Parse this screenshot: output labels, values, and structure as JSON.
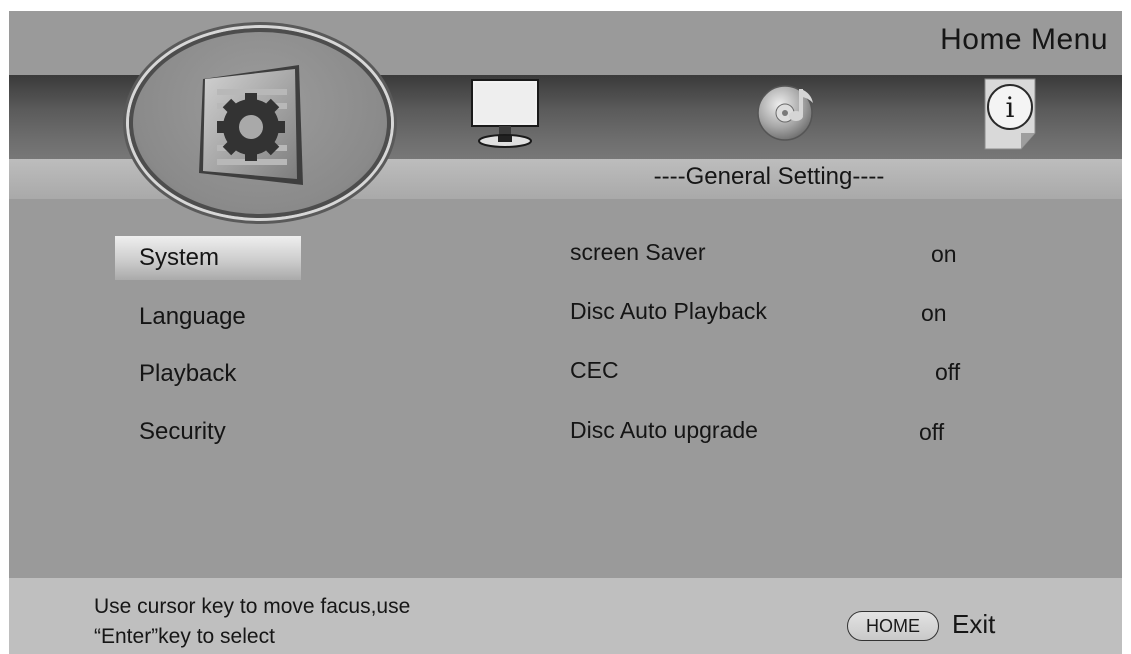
{
  "header": {
    "title": "Home  Menu"
  },
  "top_icons": [
    {
      "icon": "gear-settings-icon",
      "selected": true
    },
    {
      "icon": "monitor-display-icon",
      "selected": false
    },
    {
      "icon": "disc-music-icon",
      "selected": false
    },
    {
      "icon": "info-icon",
      "selected": false,
      "glyph": "i"
    }
  ],
  "section": {
    "title": "----General Setting----"
  },
  "left_menu": {
    "selected_index": 0,
    "items": [
      {
        "label": "System"
      },
      {
        "label": "Language"
      },
      {
        "label": "Playback"
      },
      {
        "label": "Security"
      }
    ]
  },
  "settings": [
    {
      "label": "screen Saver",
      "value": "on"
    },
    {
      "label": "Disc Auto Playback",
      "value": "on"
    },
    {
      "label": "CEC",
      "value": "off"
    },
    {
      "label": "Disc Auto upgrade",
      "value": "off"
    }
  ],
  "footer": {
    "hint_line1": "Use cursor key to move facus,use",
    "hint_line2": "“Enter”key to select",
    "home_key_label": "HOME",
    "exit_label": "Exit"
  },
  "colors": {
    "background": "#9a9a9a",
    "band_dark": "#3a3a3a",
    "strip": "#b3b3b3",
    "footer": "#bfbfbf",
    "text": "#151515"
  }
}
